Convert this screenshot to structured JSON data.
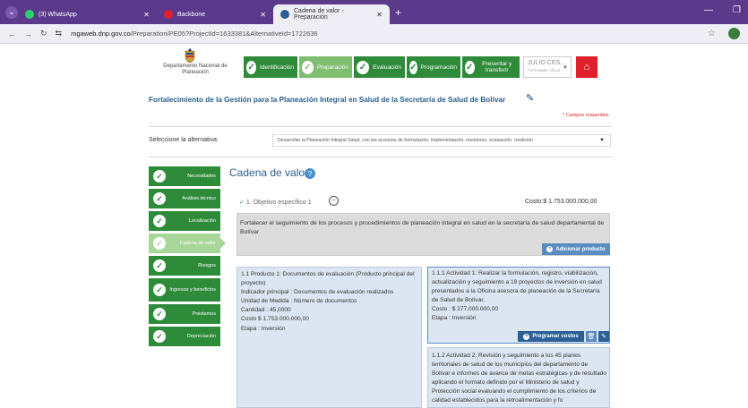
{
  "browser": {
    "tabs": [
      {
        "label": "(3) WhatsApp",
        "color": "#25d366"
      },
      {
        "label": "Backbone",
        "color": "#e0202b"
      },
      {
        "label": "Cadena de valor - Preparación",
        "color": "#2c5f96"
      }
    ],
    "new_tab": "+",
    "url_host": "mgaweb.dnp.gov.co",
    "url_path": "/Preparation/PE05?ProjectId=1633381&AlternativeId=1722636"
  },
  "header": {
    "org_name": "Departamento Nacional de Planeación",
    "steps": [
      {
        "label": "Identificación"
      },
      {
        "label": "Preparación"
      },
      {
        "label": "Evaluación"
      },
      {
        "label": "Programación"
      },
      {
        "label": "Presentar y transferir"
      }
    ],
    "current_step": "Preparación",
    "user_name": "JULIO CES...",
    "user_role": "Formulador oficial"
  },
  "project": {
    "title": "Fortalecimiento de la Gestión para la Planeación Integral en Salud de la Secretaría de Salud de Bolívar",
    "required_note": "* Campos requeridos",
    "alternative_label": "Seleccione la alternativa:",
    "alternative_value": "Desarrollar la Planeación Integral Salud, con las acciones de formulación, implementación, monitoreo, evaluación, rendición"
  },
  "sidebar": {
    "items": [
      {
        "label": "Necesidades"
      },
      {
        "label": "Análisis técnico"
      },
      {
        "label": "Localización"
      },
      {
        "label": "Cadena de valor"
      },
      {
        "label": "Riesgos"
      },
      {
        "label": "Ingresos y beneficios"
      },
      {
        "label": "Préstamos"
      },
      {
        "label": "Depreciación"
      }
    ],
    "current": "Cadena de valor"
  },
  "main": {
    "title": "Cadena de valor",
    "objective_label": "1. Objetivo específico 1",
    "objective_cost": "Costo:$ 1.753.000.000,00",
    "objective_text": "Fortalecer el seguimiento de los procesos y procedimientos de planeación integral en salud en la secretaría de salud departamental de Bolívar",
    "add_product_label": "Adicionar producto",
    "product": {
      "title": "1.1 Producto 1: Documentos de evaluación (Producto principal del proyecto)",
      "indicator": "Indicador principal : Documentos de evaluación realizados",
      "unit": "Unidad de Medida : Número de documentos",
      "quantity": "Cantidad : 45,0000",
      "cost": "Costo $ 1.753.000.000,00",
      "stage": "Etapa : Inversión"
    },
    "activities": [
      {
        "text": "1.1.1 Actividad 1: Realizar la formulación, registro, viabilización, actualización y seguimiento a 19 proyectos de inversión en salud presentados a la Oficina asesora de planeación de la Secretaría de Salud de Bolívar.",
        "cost": "Costo : $ 277.000.000,00",
        "stage": "Etapa : Inversión"
      },
      {
        "text": "1.1.2 Actividad 2: Revisión y seguimiento a los 45 planes territoriales de salud de los municipios del departamento de Bolívar e informes de avance de metas estratégicas y de resultado aplicando el formato definido por el Ministerio de salud y Protección social evaluando el cumplimiento de los criterios de calidad establecidos para la retroalimentación y fo"
      }
    ],
    "program_costs_label": "Programar costos"
  }
}
